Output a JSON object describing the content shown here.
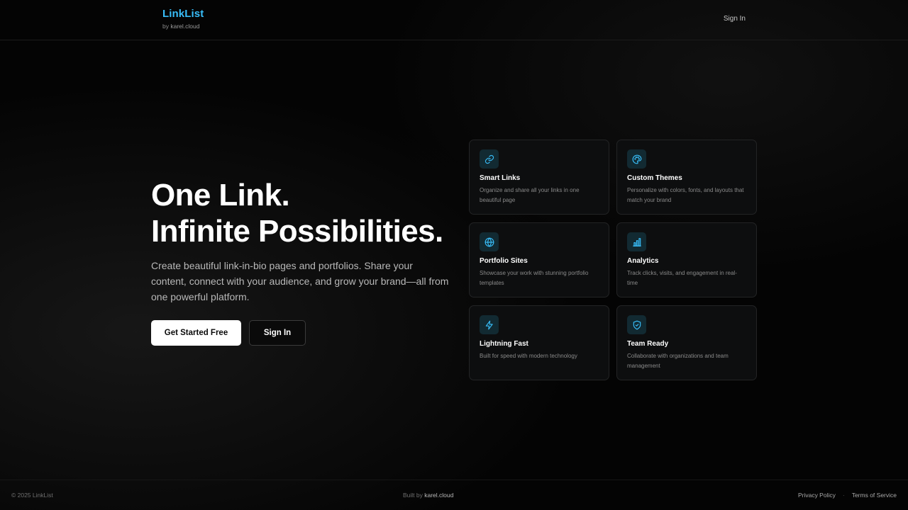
{
  "header": {
    "brand_name": "LinkList",
    "by_prefix": "by ",
    "by_host": "karel.cloud",
    "sign_in": "Sign In"
  },
  "hero": {
    "title_line1": "One Link.",
    "title_line2": "Infinite Possibilities.",
    "description": "Create beautiful link-in-bio pages and portfolios. Share your content, connect with your audience, and grow your brand—all from one powerful platform.",
    "primary_cta": "Get Started Free",
    "secondary_cta": "Sign In"
  },
  "features": [
    {
      "icon": "link-icon",
      "title": "Smart Links",
      "description": "Organize and share all your links in one beautiful page"
    },
    {
      "icon": "palette-icon",
      "title": "Custom Themes",
      "description": "Personalize with colors, fonts, and layouts that match your brand"
    },
    {
      "icon": "globe-icon",
      "title": "Portfolio Sites",
      "description": "Showcase your work with stunning portfolio templates"
    },
    {
      "icon": "bar-chart-icon",
      "title": "Analytics",
      "description": "Track clicks, visits, and engagement in real-time"
    },
    {
      "icon": "lightning-icon",
      "title": "Lightning Fast",
      "description": "Built for speed with modern technology"
    },
    {
      "icon": "shield-check-icon",
      "title": "Team Ready",
      "description": "Collaborate with organizations and team management"
    }
  ],
  "footer": {
    "copyright": "© 2025 LinkList",
    "built_prefix": "Built by ",
    "built_host": "karel.cloud",
    "privacy": "Privacy Policy",
    "separator": "·",
    "terms": "Terms of Service"
  },
  "colors": {
    "accent": "#38bdf8",
    "background": "#040404",
    "card_background": "#0d0e0f",
    "icon_tile": "#122a32",
    "primary_button": "#ffffff"
  }
}
